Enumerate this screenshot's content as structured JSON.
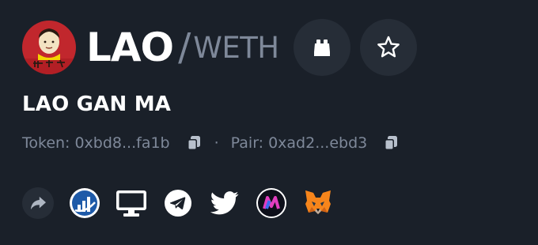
{
  "pair": {
    "base_symbol": "LAO",
    "separator": "/",
    "quote_symbol": "WETH",
    "name": "LAO GAN MA"
  },
  "addresses": {
    "token_label": "Token:",
    "token_value": "0xbd8...fa1b",
    "separator": "·",
    "pair_label": "Pair:",
    "pair_value": "0xad2...ebd3"
  },
  "header_buttons": [
    {
      "icon": "binoculars-icon"
    },
    {
      "icon": "star-icon"
    }
  ],
  "links": [
    {
      "icon": "share-icon"
    },
    {
      "icon": "chart-stats-icon"
    },
    {
      "icon": "website-icon"
    },
    {
      "icon": "telegram-icon"
    },
    {
      "icon": "twitter-icon"
    },
    {
      "icon": "dextools-icon"
    },
    {
      "icon": "metamask-icon"
    }
  ],
  "colors": {
    "background": "#1a2029",
    "button_bg": "#262d37",
    "muted_text": "#7e8899",
    "logo_red": "#c1272d"
  }
}
